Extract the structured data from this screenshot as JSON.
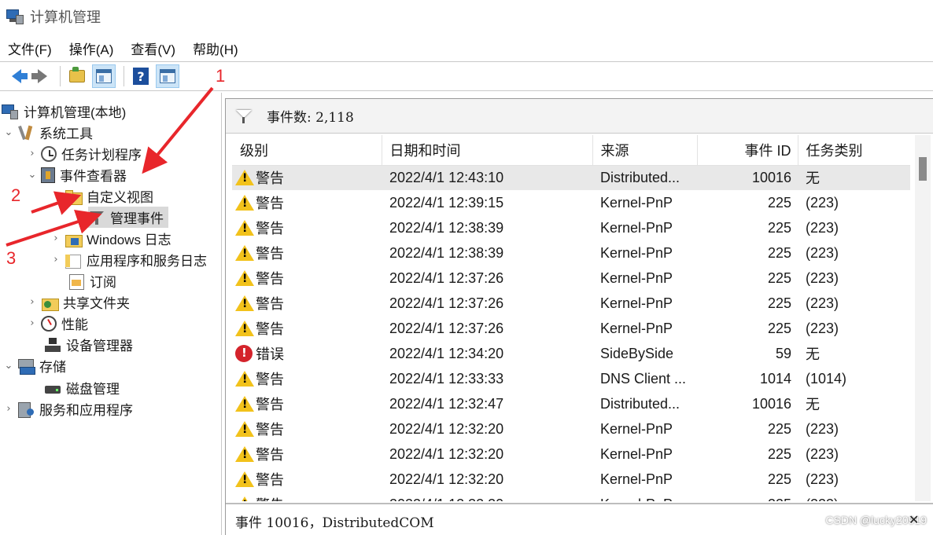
{
  "window": {
    "title": "计算机管理"
  },
  "menubar": [
    "文件(F)",
    "操作(A)",
    "查看(V)",
    "帮助(H)"
  ],
  "toolbar": {
    "buttons": [
      "back-icon",
      "forward-icon",
      "up-folder-icon",
      "show-hide-console-tree-icon",
      "help-icon",
      "show-action-pane-icon"
    ]
  },
  "annotations": [
    "1",
    "2",
    "3"
  ],
  "tree": {
    "root": "计算机管理(本地)",
    "system_tools": "系统工具",
    "task_scheduler": "任务计划程序",
    "event_viewer": "事件查看器",
    "custom_views": "自定义视图",
    "admin_events": "管理事件",
    "windows_logs": "Windows 日志",
    "app_service_logs": "应用程序和服务日志",
    "subscriptions": "订阅",
    "shared_folders": "共享文件夹",
    "performance": "性能",
    "device_manager": "设备管理器",
    "storage": "存储",
    "disk_management": "磁盘管理",
    "services_apps": "服务和应用程序"
  },
  "events_panel": {
    "count_label": "事件数: 2,118",
    "columns": {
      "level": "级别",
      "datetime": "日期和时间",
      "source": "来源",
      "event_id": "事件 ID",
      "task_category": "任务类别"
    },
    "rows": [
      {
        "level_type": "warning",
        "level": "警告",
        "datetime": "2022/4/1 12:43:10",
        "source": "Distributed...",
        "event_id": "10016",
        "task_category": "无"
      },
      {
        "level_type": "warning",
        "level": "警告",
        "datetime": "2022/4/1 12:39:15",
        "source": "Kernel-PnP",
        "event_id": "225",
        "task_category": "(223)"
      },
      {
        "level_type": "warning",
        "level": "警告",
        "datetime": "2022/4/1 12:38:39",
        "source": "Kernel-PnP",
        "event_id": "225",
        "task_category": "(223)"
      },
      {
        "level_type": "warning",
        "level": "警告",
        "datetime": "2022/4/1 12:38:39",
        "source": "Kernel-PnP",
        "event_id": "225",
        "task_category": "(223)"
      },
      {
        "level_type": "warning",
        "level": "警告",
        "datetime": "2022/4/1 12:37:26",
        "source": "Kernel-PnP",
        "event_id": "225",
        "task_category": "(223)"
      },
      {
        "level_type": "warning",
        "level": "警告",
        "datetime": "2022/4/1 12:37:26",
        "source": "Kernel-PnP",
        "event_id": "225",
        "task_category": "(223)"
      },
      {
        "level_type": "warning",
        "level": "警告",
        "datetime": "2022/4/1 12:37:26",
        "source": "Kernel-PnP",
        "event_id": "225",
        "task_category": "(223)"
      },
      {
        "level_type": "error",
        "level": "错误",
        "datetime": "2022/4/1 12:34:20",
        "source": "SideBySide",
        "event_id": "59",
        "task_category": "无"
      },
      {
        "level_type": "warning",
        "level": "警告",
        "datetime": "2022/4/1 12:33:33",
        "source": "DNS Client ...",
        "event_id": "1014",
        "task_category": "(1014)"
      },
      {
        "level_type": "warning",
        "level": "警告",
        "datetime": "2022/4/1 12:32:47",
        "source": "Distributed...",
        "event_id": "10016",
        "task_category": "无"
      },
      {
        "level_type": "warning",
        "level": "警告",
        "datetime": "2022/4/1 12:32:20",
        "source": "Kernel-PnP",
        "event_id": "225",
        "task_category": "(223)"
      },
      {
        "level_type": "warning",
        "level": "警告",
        "datetime": "2022/4/1 12:32:20",
        "source": "Kernel-PnP",
        "event_id": "225",
        "task_category": "(223)"
      },
      {
        "level_type": "warning",
        "level": "警告",
        "datetime": "2022/4/1 12:32:20",
        "source": "Kernel-PnP",
        "event_id": "225",
        "task_category": "(223)"
      },
      {
        "level_type": "warning",
        "level": "警告",
        "datetime": "2022/4/1 12:32:20",
        "source": "Kernel-PnP",
        "event_id": "225",
        "task_category": "(223)"
      }
    ],
    "status": "事件 10016，DistributedCOM"
  },
  "watermark": "CSDN @lucky20919",
  "colors": {
    "selection": "#e8e8e8",
    "annotation_red": "#e8262b",
    "accent": "#2f7fd6"
  }
}
